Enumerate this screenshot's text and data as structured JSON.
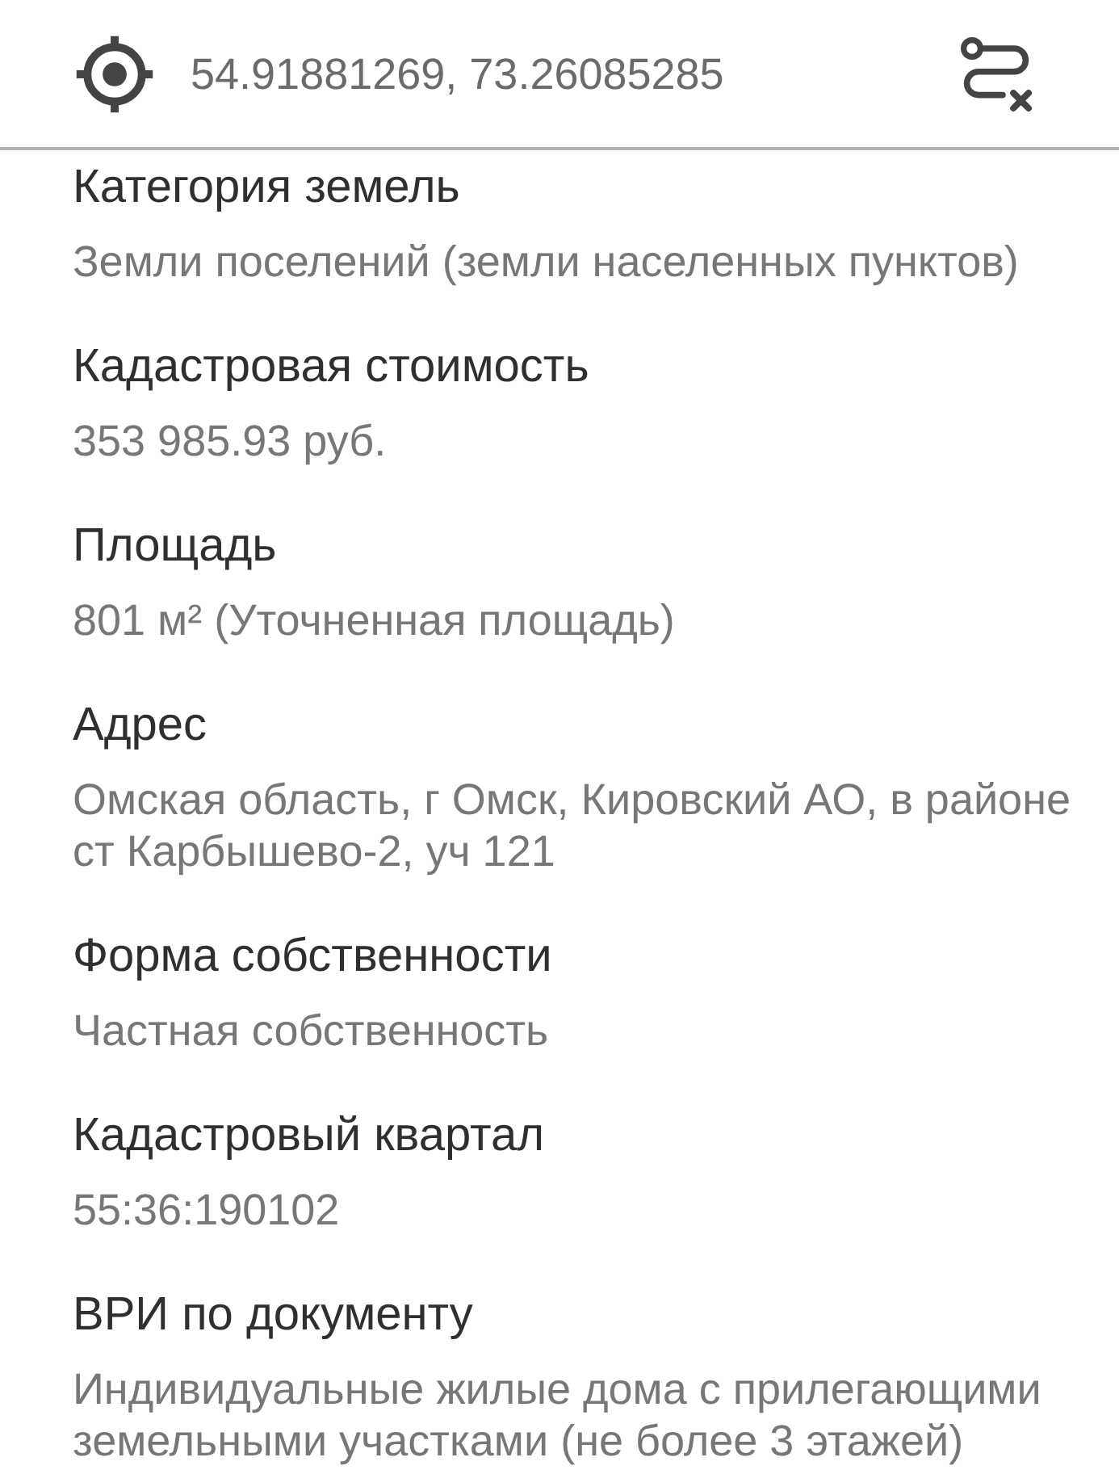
{
  "header": {
    "coordinates": "54.91881269, 73.26085285"
  },
  "fields": [
    {
      "label": "Категория земель",
      "value": "Земли поселений (земли населенных пунктов)"
    },
    {
      "label": "Кадастровая стоимость",
      "value": "353 985.93 руб."
    },
    {
      "label": "Площадь",
      "value": "801 м² (Уточненная площадь)"
    },
    {
      "label": "Адрес",
      "value": "Омская область, г Омск, Кировский АО, в районе ст Карбышево-2, уч 121"
    },
    {
      "label": "Форма собственности",
      "value": "Частная собственность"
    },
    {
      "label": "Кадастровый квартал",
      "value": "55:36:190102"
    },
    {
      "label": "ВРИ по документу",
      "value": "Индивидуальные жилые дома с прилегающими земельными участками (не более 3 этажей)"
    }
  ]
}
